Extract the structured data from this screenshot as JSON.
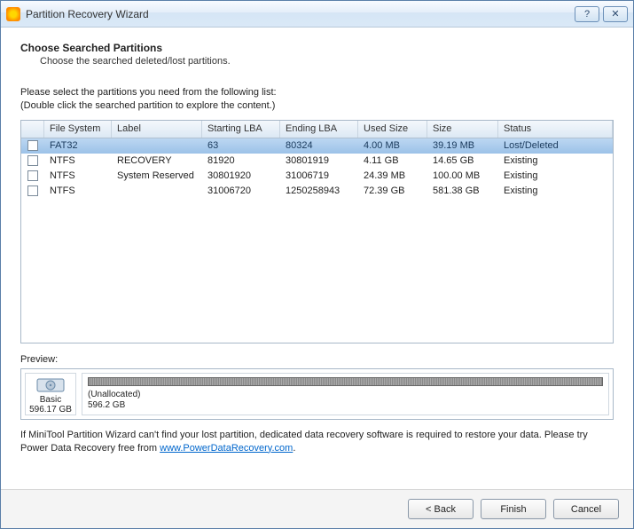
{
  "window": {
    "title": "Partition Recovery Wizard"
  },
  "header": {
    "heading": "Choose Searched Partitions",
    "subheading": "Choose the searched deleted/lost partitions.",
    "instruction1": "Please select the partitions you need from the following list:",
    "instruction2": "(Double click the searched partition to explore the content.)"
  },
  "table": {
    "columns": {
      "fs": "File System",
      "label": "Label",
      "slba": "Starting LBA",
      "elba": "Ending LBA",
      "used": "Used Size",
      "size": "Size",
      "status": "Status"
    },
    "rows": [
      {
        "fs": "FAT32",
        "label": "",
        "slba": "63",
        "elba": "80324",
        "used": "4.00 MB",
        "size": "39.19 MB",
        "status": "Lost/Deleted",
        "selected": true
      },
      {
        "fs": "NTFS",
        "label": "RECOVERY",
        "slba": "81920",
        "elba": "30801919",
        "used": "4.11 GB",
        "size": "14.65 GB",
        "status": "Existing",
        "selected": false
      },
      {
        "fs": "NTFS",
        "label": "System Reserved",
        "slba": "30801920",
        "elba": "31006719",
        "used": "24.39 MB",
        "size": "100.00 MB",
        "status": "Existing",
        "selected": false
      },
      {
        "fs": "NTFS",
        "label": "",
        "slba": "31006720",
        "elba": "1250258943",
        "used": "72.39 GB",
        "size": "581.38 GB",
        "status": "Existing",
        "selected": false
      }
    ]
  },
  "preview": {
    "label": "Preview:",
    "disk_type": "Basic",
    "disk_size": "596.17 GB",
    "unallocated_label": "(Unallocated)",
    "unallocated_size": "596.2 GB"
  },
  "note": {
    "text_before": "If MiniTool Partition Wizard can't find your lost partition, dedicated data recovery software is required to restore your data. Please try Power Data Recovery free from ",
    "link_text": "www.PowerDataRecovery.com",
    "text_after": "."
  },
  "buttons": {
    "back": "< Back",
    "finish": "Finish",
    "cancel": "Cancel"
  }
}
